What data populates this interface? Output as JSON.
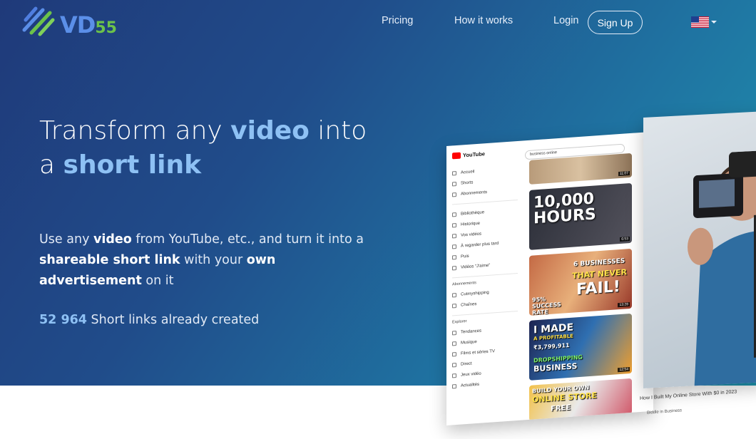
{
  "logo": {
    "text": "VD",
    "num": "55"
  },
  "nav": {
    "pricing": "Pricing",
    "how_it_works": "How it works",
    "login": "Login",
    "signup": "Sign Up",
    "language": "us-flag-icon"
  },
  "hero": {
    "headline_1": "Transform any ",
    "headline_hl1": "video",
    "headline_2": " into",
    "headline_3": "a ",
    "headline_hl2": "short link",
    "sub_1": "Use any ",
    "sub_b1": "video",
    "sub_2": " from YouTube, etc., and turn it into a ",
    "sub_b2": "shareable short link",
    "sub_3": " with your ",
    "sub_b3": "own advertisement",
    "sub_4": " on it",
    "count_num": "52 964",
    "count_text": " Short links already created"
  },
  "youtube_mock": {
    "brand": "YouTube",
    "search": "business online",
    "sidebar": [
      "Accueil",
      "Shorts",
      "Abonnements",
      "Bibliothèque",
      "Historique",
      "Vos vidéos",
      "À regarder plus tard",
      "Puis",
      "Vidéos \"J'aime\""
    ],
    "abonnements_label": "Abonnements",
    "subs": [
      "Cutmyshipping",
      "Chaînes"
    ],
    "explorer_label": "Explorer",
    "explore": [
      "Tendances",
      "Musique",
      "Films et séries TV",
      "Direct",
      "Jeux vidéo",
      "Actualités"
    ],
    "thumb2_text": "10,000 HOURS",
    "thumb2_dur": "6:53",
    "thumb1_dur": "11:07",
    "thumb3_line1": "6 BUSINESSES",
    "thumb3_line2": "THAT NEVER",
    "thumb3_line3": "FAIL!",
    "thumb3_badge": "95% SUCCESS RATE",
    "thumb3_dur": "13:28",
    "thumb4_line1": "I MADE",
    "thumb4_line2": "A PROFITABLE",
    "thumb4_amount": "₹3,799,911",
    "thumb4_line3": "DROPSHIPPING",
    "thumb4_line4": "BUSINESS",
    "thumb4_dur": "12:54",
    "thumb5_line1": "BUILD YOUR OWN",
    "thumb5_line2": "ONLINE STORE",
    "thumb5_line3": "FREE",
    "video_title": "How I Built My Online Store With $0 in 2023",
    "video_channel": "Biddle in Business"
  },
  "colors": {
    "accent": "#8ec1f4",
    "logo_blue": "#5b8fe8",
    "logo_green": "#6cc24a"
  }
}
